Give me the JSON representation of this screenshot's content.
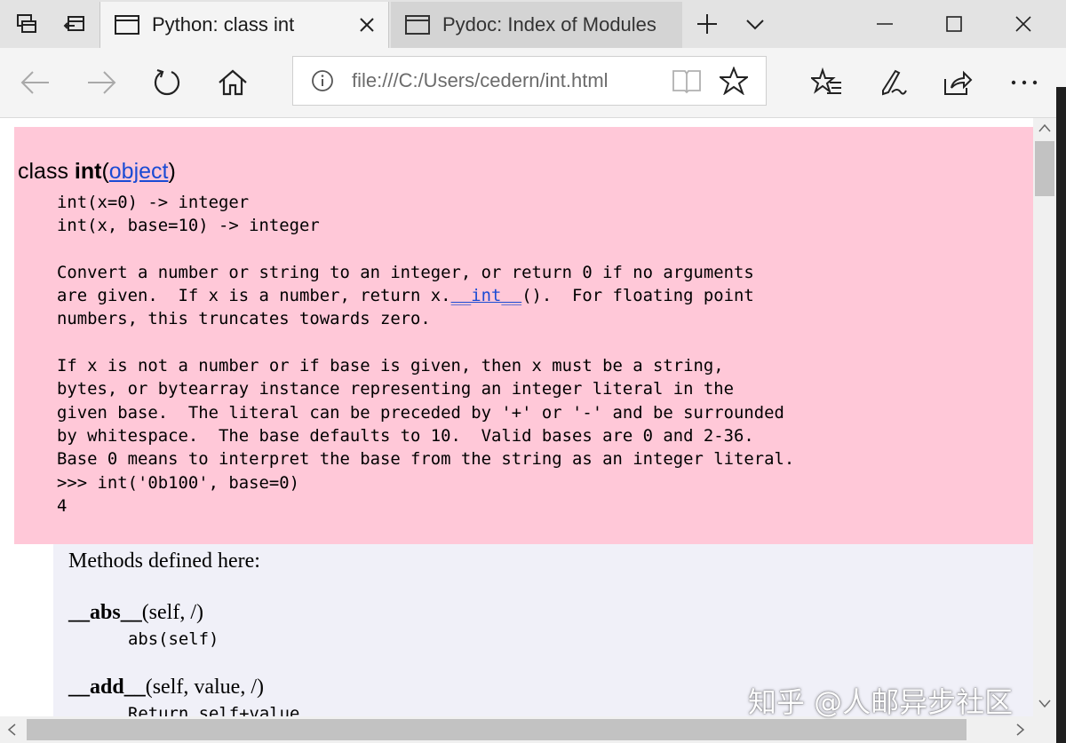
{
  "browser": {
    "tabs": [
      {
        "title": "Python: class int",
        "active": true
      },
      {
        "title": "Pydoc: Index of Modules",
        "active": false
      }
    ],
    "address_bar": {
      "url": "file:///C:/Users/cedern/int.html"
    },
    "icons": {
      "set_aside_tabs": "tabs-aside-icon",
      "restore_tabs": "tabs-restore-icon",
      "back": "arrow-left-icon",
      "forward": "arrow-right-icon",
      "refresh": "refresh-icon",
      "home": "home-icon",
      "new_tab": "plus-icon",
      "tab_list": "chevron-down-icon"
    }
  },
  "page": {
    "class_keyword": "class ",
    "class_name": "int",
    "open_paren": "(",
    "base_link": "object",
    "close_paren": ")",
    "doc_line1": "int(x=0) -> integer",
    "doc_line2": "int(x, base=10) -> integer",
    "doc_p1_a": "Convert a number or string to an integer, or return 0 if no arguments",
    "doc_p1_b1": "are given.  If x is a number, return x.",
    "doc_p1_link": "__int__",
    "doc_p1_b2": "().  For floating point",
    "doc_p1_c": "numbers, this truncates towards zero.",
    "doc_p2_a": "If x is not a number or if base is given, then x must be a string,",
    "doc_p2_b": "bytes, or bytearray instance representing an integer literal in the",
    "doc_p2_c": "given base.  The literal can be preceded by '+' or '-' and be surrounded",
    "doc_p2_d": "by whitespace.  The base defaults to 10.  Valid bases are 0 and 2-36.",
    "doc_p2_e": "Base 0 means to interpret the base from the string as an integer literal.",
    "doc_example": ">>> int('0b100', base=0)",
    "doc_result": "4",
    "methods_heading": "Methods defined here:",
    "methods": [
      {
        "name": "__abs__",
        "sig": "(self, /)",
        "doc": "abs(self)"
      },
      {
        "name": "__add__",
        "sig": "(self, value, /)",
        "doc": "Return self+value."
      }
    ]
  },
  "watermark": "知乎 @人邮异步社区",
  "colors": {
    "class_bg": "#ffc8d8",
    "methods_bg": "#f0f0f8",
    "link": "#1a4bd4",
    "titlebar": "#e3e3e3",
    "toolbar": "#f4f4f4"
  }
}
